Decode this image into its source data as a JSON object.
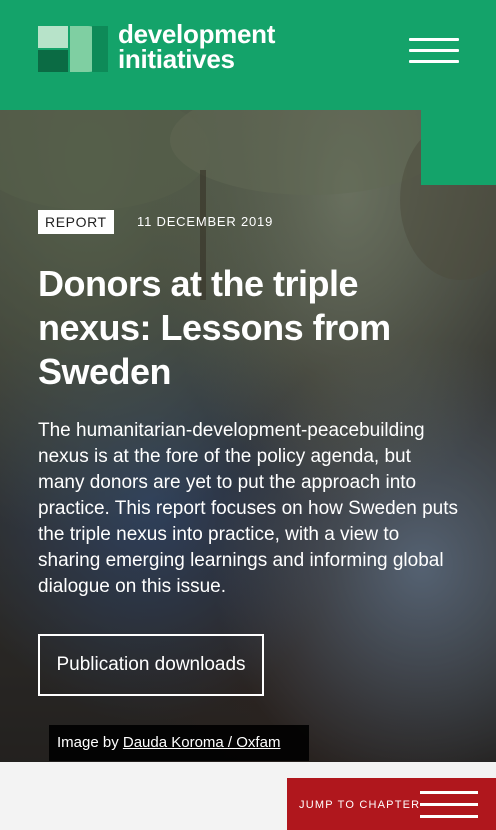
{
  "header": {
    "brand_line1": "development",
    "brand_line2": "initiatives",
    "menu_icon": "hamburger-menu-icon"
  },
  "hero": {
    "tag": "REPORT",
    "date": "11 DECEMBER 2019",
    "title": "Donors at the triple nexus: Lessons from Sweden",
    "summary": "The humanitarian-development-peacebuilding nexus is at the fore of the policy agenda, but many donors are yet to put the approach into practice. This report focuses on how Sweden puts the triple nexus into practice, with a view to sharing emerging learnings and informing global dialogue on this issue.",
    "downloads_button": "Publication downloads",
    "credit_prefix": "Image by ",
    "credit_link": "Dauda Koroma / Oxfam"
  },
  "jump": {
    "label": "JUMP TO CHAPTER",
    "icon": "menu-lines-icon"
  },
  "colors": {
    "brand_green": "#14a36a",
    "jump_red": "#b0171d"
  }
}
